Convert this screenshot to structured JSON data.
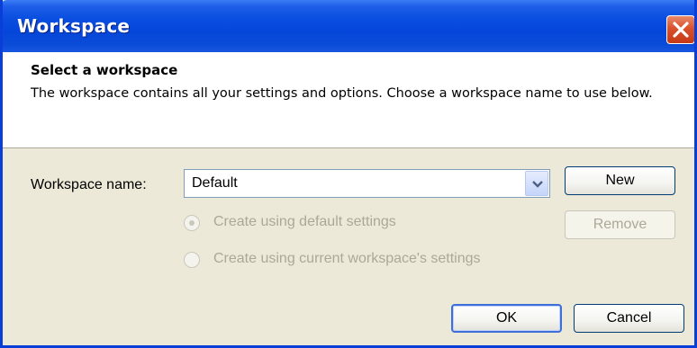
{
  "window": {
    "title": "Workspace",
    "close_icon": "close-icon"
  },
  "header": {
    "title": "Select a workspace",
    "description": "The workspace contains all your settings and options. Choose a workspace name to use below."
  },
  "form": {
    "workspace_name_label": "Workspace name:",
    "workspace_name_value": "Default",
    "dropdown_icon": "chevron-down-icon",
    "new_button": "New",
    "remove_button": "Remove",
    "remove_enabled": false,
    "options": [
      {
        "label": "Create using default settings",
        "selected": true,
        "enabled": false
      },
      {
        "label": "Create using current workspace's settings",
        "selected": false,
        "enabled": false
      }
    ]
  },
  "footer": {
    "ok_button": "OK",
    "cancel_button": "Cancel"
  },
  "colors": {
    "titlebar": "#0546da",
    "dialog_background": "#ece9d8",
    "disabled_text": "#aca899",
    "close_button": "#d9512c"
  }
}
